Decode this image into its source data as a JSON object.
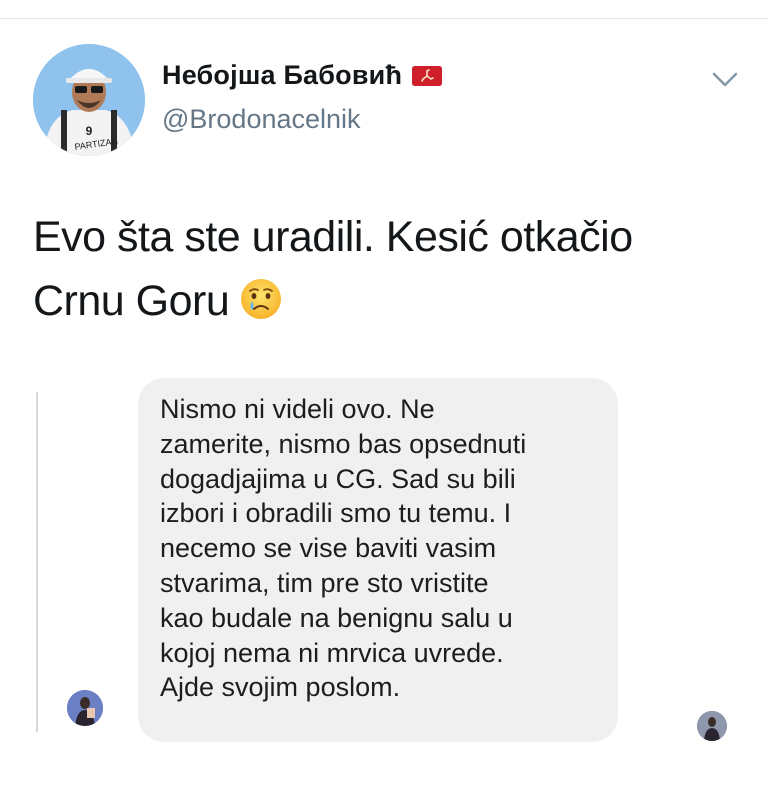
{
  "tweet": {
    "display_name": "Небојша Бабовић",
    "handle": "@Brodonacelnik",
    "avatar_icon": "profile-avatar",
    "flag_icon": "isle-of-man-flag-icon",
    "menu_icon": "chevron-down-icon",
    "text_line1": "Evo šta ste uradili. Kesić otkačio",
    "text_line2": "Crnu Goru",
    "emoji_icon": "crying-face-emoji",
    "avatar_jersey_number": "9",
    "avatar_jersey_text": "PARTIZAN"
  },
  "screenshot": {
    "message_lines": [
      "Nismo ni videli ovo. Ne",
      "zamerite, nismo bas opsednuti",
      "dogadjajima u CG. Sad su bili",
      "izbori i obradili smo tu temu. I",
      "necemo se vise baviti vasim",
      "stvarima, tim pre sto vristite",
      "kao budale na benignu salu u",
      "kojoj nema ni mrvica uvrede.",
      "Ajde svojim poslom."
    ],
    "bubble_color": "#f0f0f0"
  },
  "colors": {
    "handle": "#657786",
    "divider": "#e1e8ed",
    "flag_red": "#cf1f2a"
  }
}
